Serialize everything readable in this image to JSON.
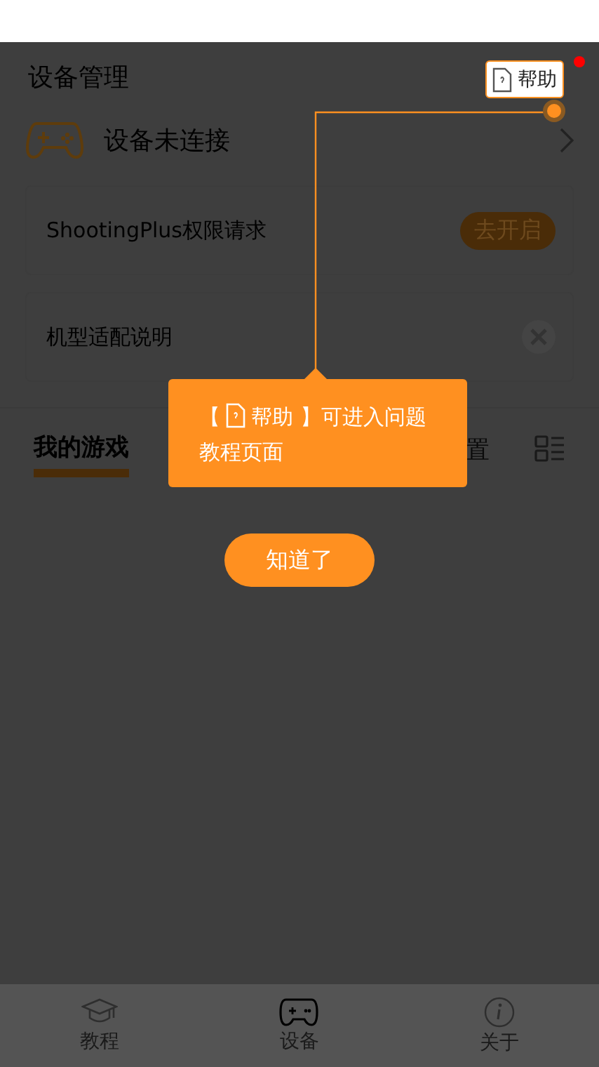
{
  "header": {
    "title": "设备管理",
    "help_button": {
      "label": "帮助",
      "badge": true
    }
  },
  "device": {
    "status": "设备未连接"
  },
  "cards": [
    {
      "kind": "action",
      "title": "ShootingPlus权限请求",
      "button": "去开启"
    },
    {
      "kind": "dismissable",
      "title": "机型适配说明"
    }
  ],
  "tabs": [
    {
      "label": "我的游戏",
      "selected": true
    },
    {
      "label": "置",
      "selected": false
    }
  ],
  "guide": {
    "bracket": "【",
    "text": "帮助 】可进入问题",
    "text_line2": "教程页面",
    "button": "知道了"
  },
  "bottom_nav": [
    {
      "kind": "tutorial",
      "label": "教程",
      "selected": false
    },
    {
      "kind": "device",
      "label": "设备",
      "selected": true
    },
    {
      "kind": "about",
      "label": "关于",
      "selected": false
    }
  ]
}
